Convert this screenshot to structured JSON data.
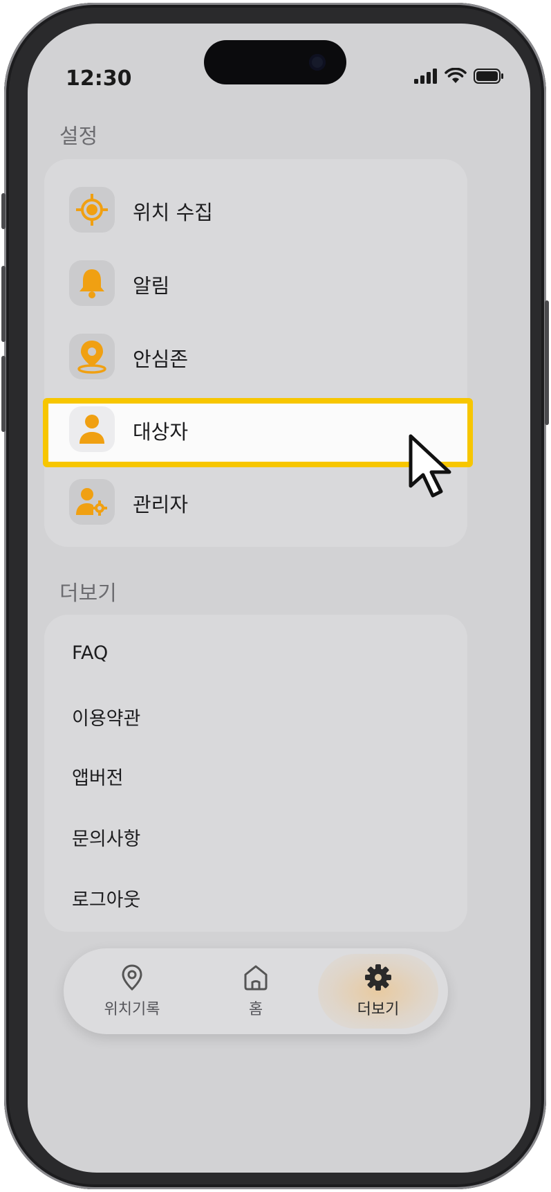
{
  "status_bar": {
    "time": "12:30"
  },
  "settings": {
    "section_title": "설정",
    "items": [
      {
        "label": "위치 수집",
        "icon": "target-icon"
      },
      {
        "label": "알림",
        "icon": "bell-icon"
      },
      {
        "label": "안심존",
        "icon": "location-pin-icon"
      },
      {
        "label": "대상자",
        "icon": "person-icon"
      },
      {
        "label": "관리자",
        "icon": "admin-gear-icon"
      }
    ]
  },
  "more": {
    "section_title": "더보기",
    "items": [
      {
        "label": "FAQ"
      },
      {
        "label": "이용약관"
      },
      {
        "label": "앱버전"
      },
      {
        "label": "문의사항"
      },
      {
        "label": "로그아웃"
      }
    ]
  },
  "tabbar": {
    "tabs": [
      {
        "label": "위치기록",
        "icon": "location-pin-icon"
      },
      {
        "label": "홈",
        "icon": "home-icon"
      },
      {
        "label": "더보기",
        "icon": "gear-icon",
        "active": true
      }
    ]
  },
  "colors": {
    "accent": "#F0A012",
    "highlight": "#F7C600"
  }
}
